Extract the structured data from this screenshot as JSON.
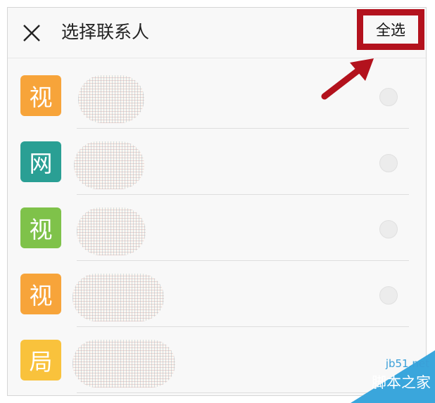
{
  "header": {
    "title": "选择联系人",
    "select_all_label": "全选"
  },
  "contacts": [
    {
      "initial": "视",
      "color": "#f7a43a"
    },
    {
      "initial": "网",
      "color": "#2a9f94"
    },
    {
      "initial": "视",
      "color": "#7fc24a"
    },
    {
      "initial": "视",
      "color": "#f7a43a"
    },
    {
      "initial": "局",
      "color": "#f9c23c"
    }
  ],
  "accent_color": "#b3121d",
  "watermark": {
    "url": "jb51.net",
    "name": "脚本之家"
  }
}
